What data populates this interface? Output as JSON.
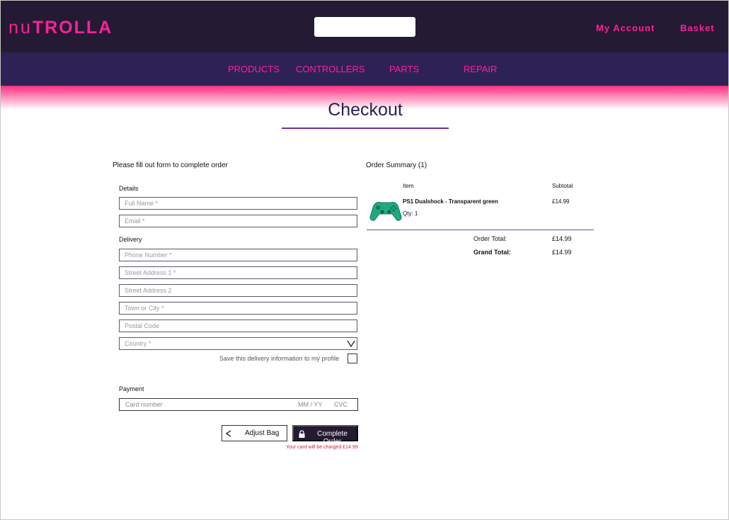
{
  "header": {
    "logo_light": "nu",
    "logo_bold": "TROLLA",
    "search_placeholder": "",
    "account_label": "My Account",
    "basket_label": "Basket"
  },
  "nav": {
    "items": [
      {
        "label": "PRODUCTS"
      },
      {
        "label": "CONTROLLERS"
      },
      {
        "label": "PARTS"
      },
      {
        "label": "REPAIR"
      }
    ]
  },
  "page": {
    "title": "Checkout"
  },
  "form": {
    "intro": "Please fill out form to complete order",
    "details_heading": "Details",
    "full_name_placeholder": "Full Name *",
    "email_placeholder": "Email *",
    "delivery_heading": "Delivery",
    "phone_placeholder": "Phone Number *",
    "street1_placeholder": "Street Address 1 *",
    "street2_placeholder": "Street Address 2",
    "town_placeholder": "Town or City *",
    "postal_placeholder": "Postal Code",
    "country_placeholder": "Country *",
    "save_info_label": "Save this delivery information to my profile",
    "payment_heading": "Payment",
    "card_number_placeholder": "Card number",
    "card_expiry_placeholder": "MM / YY",
    "card_cvc_placeholder": "CVC",
    "adjust_label": "Adjust Bag",
    "complete_label": "Complete Order",
    "charge_note": "Your card will be charged £14.99"
  },
  "summary": {
    "heading": "Order Summary (1)",
    "col_item": "Item",
    "col_subtotal": "Subtotal",
    "item_name": "PS1 Dualshock - Transparent green",
    "item_qty": "Qty: 1",
    "item_subtotal": "£14.99",
    "order_total_label": "Order Total:",
    "order_total_value": "£14.99",
    "grand_total_label": "Grand Total:",
    "grand_total_value": "£14.99"
  },
  "colors": {
    "accent": "#ff1f9a",
    "header_bg": "#241a33",
    "nav_bg": "#2d2255",
    "title_text": "#2a2350"
  }
}
